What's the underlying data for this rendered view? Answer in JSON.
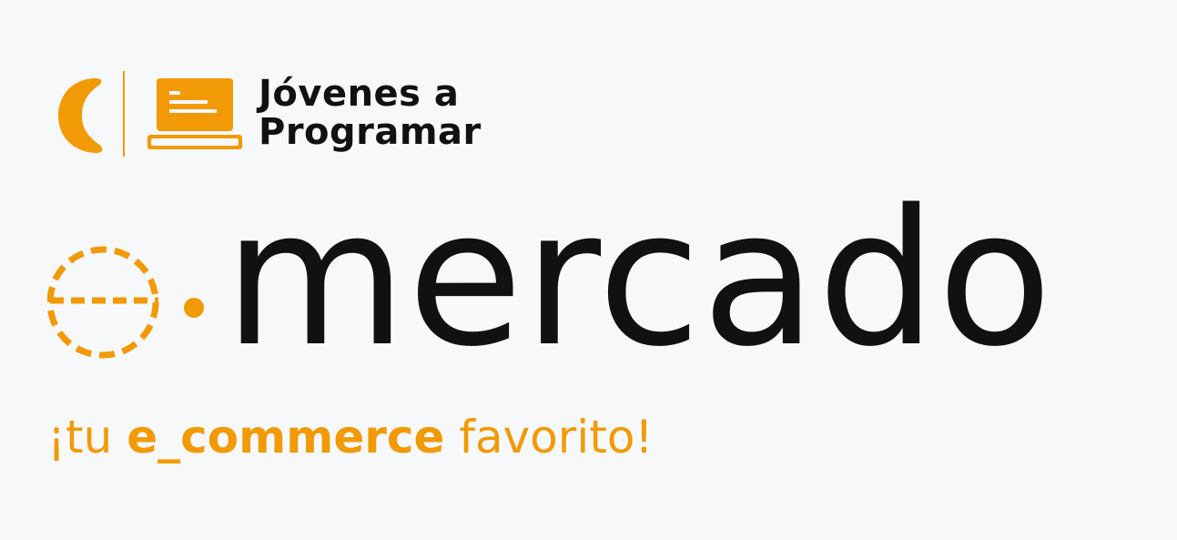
{
  "logo": {
    "line1": "Jóvenes a",
    "line2": "Programar",
    "moon_icon": "crescent-moon-icon",
    "laptop_icon": "laptop-icon",
    "accent_color": "#f29a06"
  },
  "brand": {
    "word": "mercado",
    "e_mark_icon": "dashed-e-icon",
    "text_color": "#111111"
  },
  "tagline": {
    "prefix": "¡tu ",
    "highlight": "e_commerce",
    "suffix": " favorito!",
    "color": "#f29a06"
  }
}
